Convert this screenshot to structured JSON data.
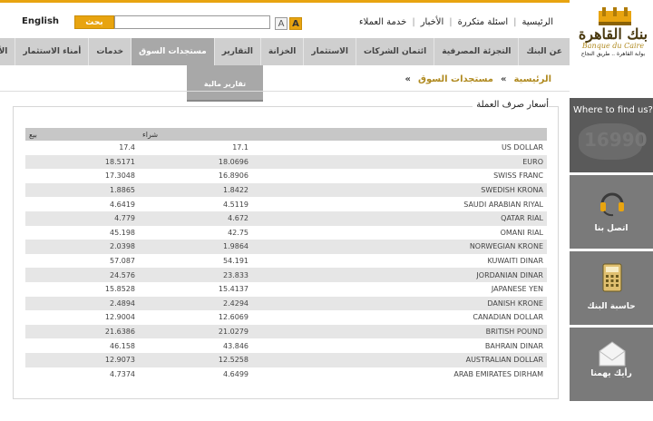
{
  "header": {
    "language_label": "English",
    "search_button": "بحث",
    "search_placeholder": "",
    "font_small": "A",
    "font_large": "A",
    "links": [
      "الرئيسية",
      "اسئلة متكررة",
      "الأخبار",
      "خدمة العملاء"
    ]
  },
  "logo": {
    "arabic_name": "بنك القاهرة",
    "latin_name": "Banque du Caire",
    "tagline": "بوابة القاهرة .. طريق النجاح"
  },
  "nav": {
    "items": [
      "عن البنك",
      "التجزئة المصرفية",
      "ائتمان الشركات",
      "الاستثمار",
      "الخزانة",
      "التقارير",
      "مستجدات السوق",
      "خدمات",
      "أمناء الاستثمار",
      "الأ"
    ],
    "active_index": 6,
    "submenu_item": "تقارير مالية"
  },
  "breadcrumb": {
    "home": "الرئيسية",
    "separator": "»",
    "current": "مستجدات السوق",
    "trailing": "»"
  },
  "rates": {
    "title": "أسعار صرف العملة",
    "headers": {
      "currency": "",
      "buy": "شراء",
      "sell": "بيع"
    },
    "rows": [
      {
        "currency": "US DOLLAR",
        "buy": "17.1",
        "sell": "17.4"
      },
      {
        "currency": "EURO",
        "buy": "18.0696",
        "sell": "18.5171"
      },
      {
        "currency": "SWISS FRANC",
        "buy": "16.8906",
        "sell": "17.3048"
      },
      {
        "currency": "SWEDISH KRONA",
        "buy": "1.8422",
        "sell": "1.8865"
      },
      {
        "currency": "SAUDI ARABIAN RIYAL",
        "buy": "4.5119",
        "sell": "4.6419"
      },
      {
        "currency": "QATAR RIAL",
        "buy": "4.672",
        "sell": "4.779"
      },
      {
        "currency": "OMANI RIAL",
        "buy": "42.75",
        "sell": "45.198"
      },
      {
        "currency": "NORWEGIAN KRONE",
        "buy": "1.9864",
        "sell": "2.0398"
      },
      {
        "currency": "KUWAITI DINAR",
        "buy": "54.191",
        "sell": "57.087"
      },
      {
        "currency": "JORDANIAN DINAR",
        "buy": "23.833",
        "sell": "24.576"
      },
      {
        "currency": "JAPANESE YEN",
        "buy": "15.4137",
        "sell": "15.8528"
      },
      {
        "currency": "DANISH KRONE",
        "buy": "2.4294",
        "sell": "2.4894"
      },
      {
        "currency": "CANADIAN DOLLAR",
        "buy": "12.6069",
        "sell": "12.9004"
      },
      {
        "currency": "BRITISH POUND",
        "buy": "21.0279",
        "sell": "21.6386"
      },
      {
        "currency": "BAHRAIN DINAR",
        "buy": "43.846",
        "sell": "46.158"
      },
      {
        "currency": "AUSTRALIAN DOLLAR",
        "buy": "12.5258",
        "sell": "12.9073"
      },
      {
        "currency": "ARAB EMIRATES DIRHAM",
        "buy": "4.6499",
        "sell": "4.7374"
      }
    ]
  },
  "sidebar": {
    "where_to_find": "Where to find us?",
    "hotline": "16990",
    "tools": [
      {
        "label": "اتصل بنا",
        "icon": "headset-icon"
      },
      {
        "label": "حاسبة البنك",
        "icon": "calculator-icon"
      },
      {
        "label": "رأيك يهمنا",
        "icon": "envelope-icon"
      }
    ]
  },
  "colors": {
    "accent": "#e8a410",
    "nav_bg": "#cfcfcf",
    "nav_active": "#a8a8a8",
    "sidebar_bg": "#7a7a7a",
    "gold_text": "#b08a20"
  }
}
